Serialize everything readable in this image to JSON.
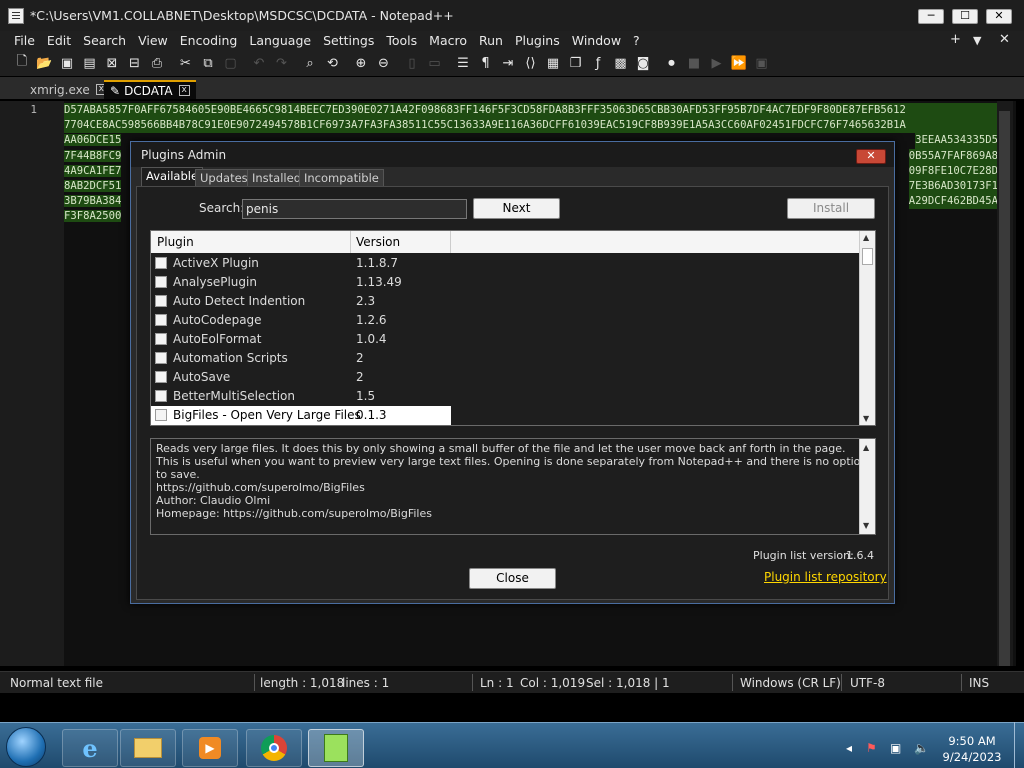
{
  "window": {
    "title": "*C:\\Users\\VM1.COLLABNET\\Desktop\\MSDCSC\\DCDATA - Notepad++",
    "minimize": "─",
    "maximize": "☐",
    "close": "✕"
  },
  "menu": {
    "items": [
      "File",
      "Edit",
      "Search",
      "View",
      "Encoding",
      "Language",
      "Settings",
      "Tools",
      "Macro",
      "Run",
      "Plugins",
      "Window",
      "?"
    ],
    "plus": "+",
    "arrow": "▼",
    "close": "✕"
  },
  "toolbar": {
    "icons": [
      "new-file-icon",
      "open-file-icon",
      "save-icon",
      "save-all-icon",
      "close-icon",
      "close-all-icon",
      "print-icon",
      "cut-icon",
      "copy-icon",
      "paste-icon",
      "undo-icon",
      "redo-icon",
      "find-icon",
      "replace-icon",
      "zoom-in-icon",
      "zoom-out-icon",
      "sync-v-icon",
      "sync-h-icon",
      "word-wrap-icon",
      "show-all-chars-icon",
      "indent-guide-icon",
      "udl-icon",
      "doc-map-icon",
      "doc-list-icon",
      "function-list-icon",
      "folder-workspace-icon",
      "monitor-icon",
      "record-macro-icon",
      "stop-record-icon",
      "play-macro-icon",
      "run-macro-icon",
      "save-macro-icon"
    ]
  },
  "tabs": [
    {
      "label": "xmrig.exe",
      "close": "x"
    },
    {
      "label": "DCDATA",
      "close": "x"
    }
  ],
  "editor": {
    "line_number": "1",
    "lines": [
      "D57ABA5857F0AFF67584605E90BE4665C9814BEEC7ED390E0271A42F098683FF146F5F3CD58FDA8B3FFF35063D65CBB30AFD53FF95B7DF4AC7EDF9F80DE87EFB5612",
      "7704CE8AC598566BB4B78C91E0E9072494578B1CF6973A7FA3FA38511C55C13633A9E116A36DCFF61039EAC519CF8B939E1A5A3CC60AF02451FDCFC76F7465632B1A",
      "AA06DCE15",
      "7F44B8FC9",
      "4A9CA1FE7",
      "8AB2DCF51",
      "3B79BA384",
      "F3F8A2500"
    ],
    "lines_right": [
      "",
      "",
      "3EEAA534335D5",
      "0B55A7FAF869A8",
      "09F8FE10C7E28D",
      "7E3B6AD30173F1",
      "A29DCF462BD45A",
      ""
    ]
  },
  "dialog": {
    "title": "Plugins Admin",
    "close": "✕",
    "tabs": [
      "Available",
      "Updates",
      "Installed",
      "Incompatible"
    ],
    "search_label": "Search:",
    "search_value": "penis",
    "next_button": "Next",
    "install_button": "Install",
    "columns": {
      "plugin": "Plugin",
      "version": "Version"
    },
    "plugins": [
      {
        "name": "ActiveX Plugin",
        "version": "1.1.8.7"
      },
      {
        "name": "AnalysePlugin",
        "version": "1.13.49"
      },
      {
        "name": "Auto Detect Indention",
        "version": "2.3"
      },
      {
        "name": "AutoCodepage",
        "version": "1.2.6"
      },
      {
        "name": "AutoEolFormat",
        "version": "1.0.4"
      },
      {
        "name": "Automation Scripts",
        "version": "2"
      },
      {
        "name": "AutoSave",
        "version": "2"
      },
      {
        "name": "BetterMultiSelection",
        "version": "1.5"
      },
      {
        "name": "BigFiles - Open Very Large Files",
        "version": "0.1.3"
      }
    ],
    "description": [
      "Reads very large files. It does this by only showing a small buffer of the file and let the user move back anf forth in the page.",
      "This is useful when you want to preview very large text files. Opening is done separately from Notepad++ and there is no option to save.",
      "https://github.com/superolmo/BigFiles",
      "Author: Claudio Olmi",
      "Homepage: https://github.com/superolmo/BigFiles"
    ],
    "plugin_list_version_label": "Plugin list version:",
    "plugin_list_version": "1.6.4",
    "repo_link": "Plugin list repository",
    "close_button": "Close"
  },
  "status": {
    "file_type": "Normal text file",
    "length": "length : 1,018",
    "lines": "lines : 1",
    "ln": "Ln : 1",
    "col": "Col : 1,019",
    "sel": "Sel : 1,018 | 1",
    "eol": "Windows (CR LF)",
    "encoding": "UTF-8",
    "ins": "INS"
  },
  "taskbar": {
    "time": "9:50 AM",
    "date": "9/24/2023",
    "apps": [
      "internet-explorer-icon",
      "file-explorer-icon",
      "media-player-icon",
      "chrome-icon",
      "notepad-plus-plus-icon"
    ],
    "tray_arrow": "◂"
  }
}
